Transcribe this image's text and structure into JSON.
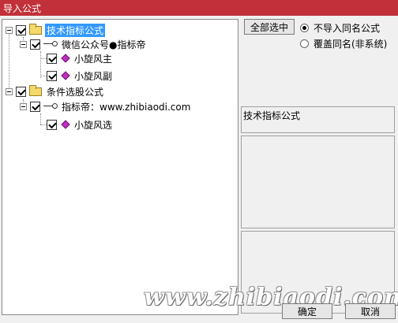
{
  "window": {
    "title": "导入公式"
  },
  "tree": {
    "group1": {
      "label": "技术指标公式",
      "child": {
        "label": "微信公众号●指标帝",
        "items": [
          "小旋风主",
          "小旋风副"
        ]
      }
    },
    "group2": {
      "label": "条件选股公式",
      "child": {
        "label": "指标帝：www.zhibiaodi.com",
        "items": [
          "小旋风选"
        ]
      }
    }
  },
  "options": {
    "select_all": "全部选中",
    "radio_skip": "不导入同名公式",
    "radio_overwrite": "覆盖同名(非系统)"
  },
  "detail": {
    "title": "技术指标公式"
  },
  "footer": {
    "ok": "确定",
    "cancel": "取消"
  },
  "watermark": "www.zhibiaodi.com",
  "colors": {
    "title_bar": "#c2303a",
    "selection": "#3399ff"
  }
}
